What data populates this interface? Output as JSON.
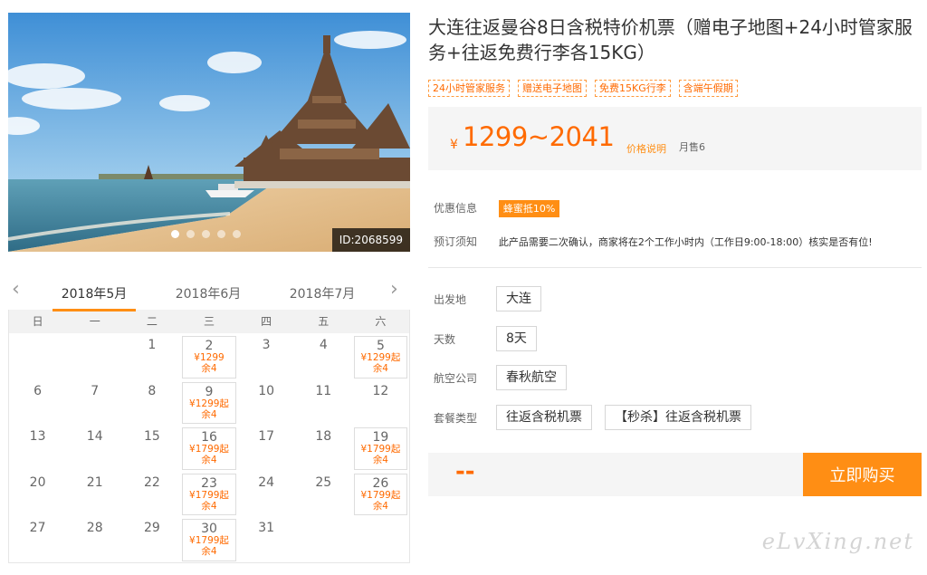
{
  "hero": {
    "id_label": "ID:2068599",
    "slide_count": 5,
    "active_slide": 1
  },
  "calendar": {
    "months": [
      "2018年5月",
      "2018年6月",
      "2018年7月"
    ],
    "active_month": 0,
    "weekdays": [
      "日",
      "一",
      "二",
      "三",
      "四",
      "五",
      "六"
    ],
    "days": [
      {
        "day": ""
      },
      {
        "day": ""
      },
      {
        "day": "1"
      },
      {
        "day": "2",
        "price": "¥1299",
        "stock": "余4"
      },
      {
        "day": "3"
      },
      {
        "day": "4"
      },
      {
        "day": "5",
        "price": "¥1299起",
        "stock": "余4"
      },
      {
        "day": "6"
      },
      {
        "day": "7"
      },
      {
        "day": "8"
      },
      {
        "day": "9",
        "price": "¥1299起",
        "stock": "余4"
      },
      {
        "day": "10"
      },
      {
        "day": "11"
      },
      {
        "day": "12"
      },
      {
        "day": "13"
      },
      {
        "day": "14"
      },
      {
        "day": "15"
      },
      {
        "day": "16",
        "price": "¥1799起",
        "stock": "余4"
      },
      {
        "day": "17"
      },
      {
        "day": "18"
      },
      {
        "day": "19",
        "price": "¥1799起",
        "stock": "余4"
      },
      {
        "day": "20"
      },
      {
        "day": "21"
      },
      {
        "day": "22"
      },
      {
        "day": "23",
        "price": "¥1799起",
        "stock": "余4"
      },
      {
        "day": "24"
      },
      {
        "day": "25"
      },
      {
        "day": "26",
        "price": "¥1799起",
        "stock": "余4"
      },
      {
        "day": "27"
      },
      {
        "day": "28"
      },
      {
        "day": "29"
      },
      {
        "day": "30",
        "price": "¥1799起",
        "stock": "余4"
      },
      {
        "day": "31"
      },
      {
        "day": ""
      },
      {
        "day": ""
      }
    ]
  },
  "product": {
    "title": "大连往返曼谷8日含税特价机票（赠电子地图+24小时管家服务+往返免费行李各15KG）",
    "tags": [
      "24小时管家服务",
      "赠送电子地图",
      "免费15KG行李",
      "含端午假期"
    ],
    "price_symbol": "¥",
    "price_range": "1299~2041",
    "price_note": "价格说明",
    "sold": "月售6"
  },
  "info": {
    "promo_label": "优惠信息",
    "promo_value": "蜂蜜抵10%",
    "notice_label": "预订须知",
    "notice_value": "此产品需要二次确认，商家将在2个工作小时内（工作日9:00-18:00）核实是否有位!"
  },
  "options": {
    "departure": {
      "label": "出发地",
      "values": [
        "大连"
      ]
    },
    "days": {
      "label": "天数",
      "values": [
        "8天"
      ]
    },
    "airline": {
      "label": "航空公司",
      "values": [
        "春秋航空"
      ]
    },
    "package": {
      "label": "套餐类型",
      "values": [
        "往返含税机票",
        "【秒杀】往返含税机票"
      ]
    }
  },
  "buy": {
    "price": "--",
    "button": "立即购买"
  },
  "watermark": "eLvXing.net",
  "colors": {
    "accent": "#ff8e14",
    "price": "#ff6a00",
    "sky": "#6fb3e4",
    "sea": "#4f97b3",
    "sand": "#e9c79a",
    "temple": "#6b4a33"
  }
}
